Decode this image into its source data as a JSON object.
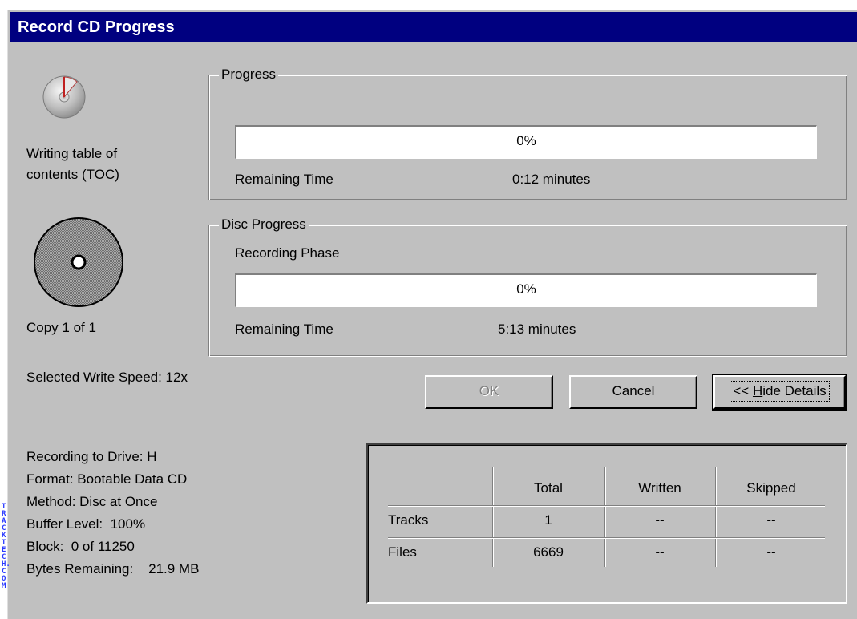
{
  "window": {
    "title": "Record CD Progress"
  },
  "left_panel": {
    "status_icon": "cd-writing-icon",
    "status_text_line1": "Writing table of",
    "status_text_line2": "contents (TOC)",
    "disc_icon": "disc-icon",
    "copy_text": "Copy 1 of 1",
    "write_speed": "Selected Write Speed: 12x"
  },
  "progress_group": {
    "title": "Progress",
    "percent": "0%",
    "progress_fraction": 0,
    "remaining_label": "Remaining Time",
    "remaining_value": "0:12 minutes"
  },
  "disc_progress_group": {
    "title": "Disc Progress",
    "phase": "Recording Phase",
    "percent": "0%",
    "progress_fraction": 0,
    "remaining_label": "Remaining Time",
    "remaining_value": "5:13 minutes"
  },
  "buttons": {
    "ok": "OK",
    "cancel": "Cancel",
    "hide_details_prefix": "<< ",
    "hide_details_mnemonic": "H",
    "hide_details_rest": "ide Details"
  },
  "details": {
    "drive": "Recording to Drive: H",
    "format": "Format: Bootable Data CD",
    "method": "Method: Disc at Once",
    "buffer": "Buffer Level:  100%",
    "block": "Block:  0 of 11250",
    "bytes_remaining": "Bytes Remaining:    21.9 MB"
  },
  "stats_table": {
    "headers": [
      "",
      "Total",
      "Written",
      "Skipped"
    ],
    "rows": [
      {
        "label": "Tracks",
        "total": "1",
        "written": "--",
        "skipped": "--"
      },
      {
        "label": "Files",
        "total": "6669",
        "written": "--",
        "skipped": "--"
      }
    ]
  },
  "watermark": "TRACKTECH.COM",
  "colors": {
    "titlebar": "#000080",
    "face": "#c0c0c0",
    "watermark": "#2a3aff"
  }
}
